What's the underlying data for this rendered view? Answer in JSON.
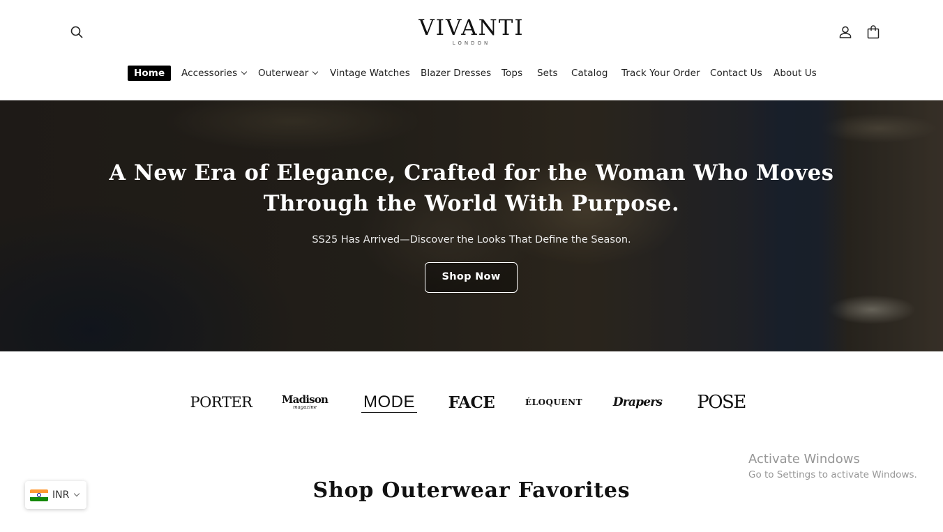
{
  "brand": {
    "name": "VIVANTI",
    "location": "LONDON"
  },
  "nav": {
    "items": [
      {
        "label": "Home",
        "active": true
      },
      {
        "label": "Accessories",
        "dropdown": true
      },
      {
        "label": "Outerwear",
        "dropdown": true
      },
      {
        "label": "Vintage Watches"
      },
      {
        "label": "Blazer Dresses"
      },
      {
        "label": "Tops"
      },
      {
        "label": "Sets"
      },
      {
        "label": "Catalog"
      },
      {
        "label": "Track Your Order"
      },
      {
        "label": "Contact Us"
      },
      {
        "label": "About Us"
      }
    ]
  },
  "header_icons": {
    "search": "search-icon",
    "account": "account-icon",
    "cart": "cart-icon"
  },
  "hero": {
    "title": "A New Era of Elegance, Crafted for the Woman Who Moves Through the World With Purpose.",
    "subtitle": "SS25 Has Arrived—Discover the Looks That Define the Season.",
    "cta_label": "Shop Now"
  },
  "press": {
    "logos": [
      {
        "name": "PORTER"
      },
      {
        "name": "Madison",
        "sub": "magazine"
      },
      {
        "name": "MODE"
      },
      {
        "name": "FACE"
      },
      {
        "name": "ÉLOQUENT"
      },
      {
        "name": "Drapers"
      },
      {
        "name": "POSE"
      }
    ]
  },
  "section": {
    "title": "Shop Outerwear Favorites"
  },
  "currency": {
    "code": "INR",
    "flag": "india-flag-icon"
  },
  "os_watermark": {
    "title": "Activate Windows",
    "subtitle": "Go to Settings to activate Windows."
  },
  "colors": {
    "nav_active_bg": "#000000",
    "text": "#121212",
    "hero_text": "#ffffff"
  }
}
